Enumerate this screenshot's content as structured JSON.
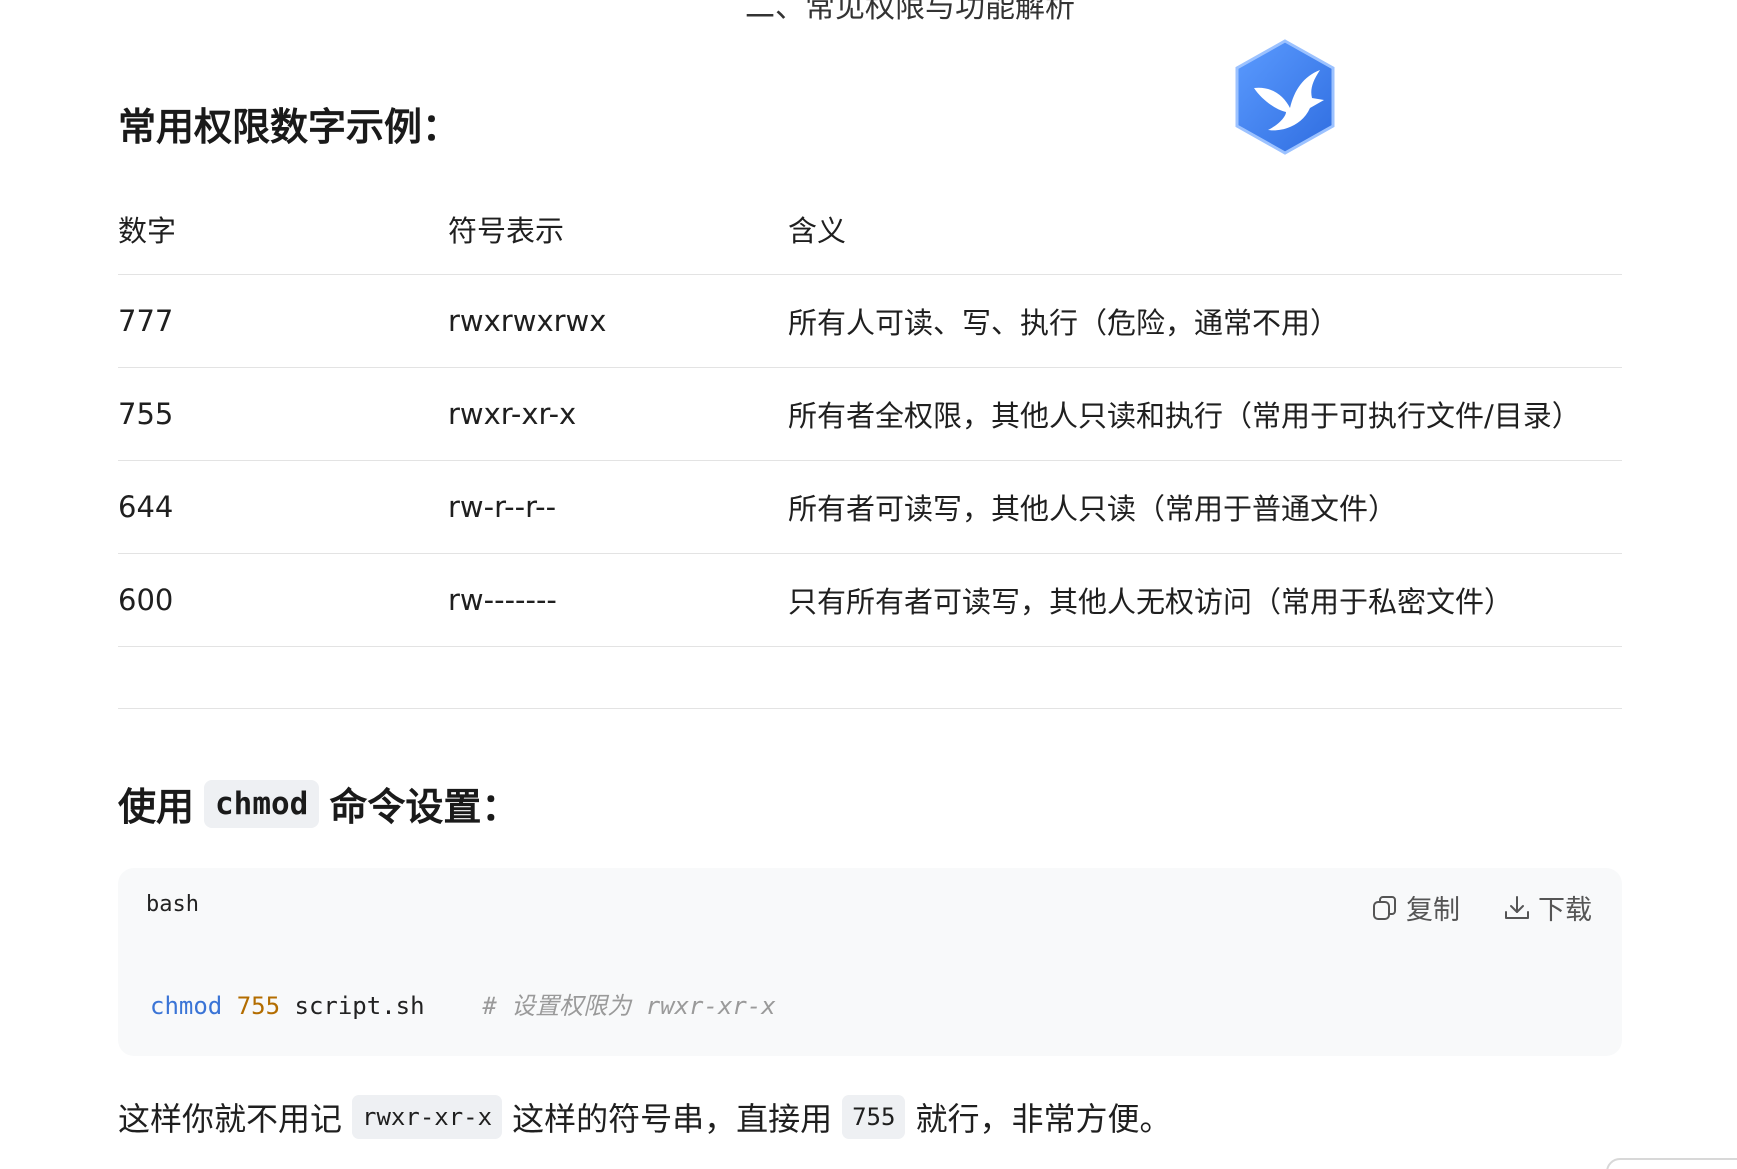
{
  "top_cut_text": "二、常见权限与功能解析",
  "section1": {
    "title": "常用权限数字示例："
  },
  "table": {
    "headers": [
      "数字",
      "符号表示",
      "含义"
    ],
    "rows": [
      [
        "777",
        "rwxrwxrwx",
        "所有人可读、写、执行（危险，通常不用）"
      ],
      [
        "755",
        "rwxr-xr-x",
        "所有者全权限，其他人只读和执行（常用于可执行文件/目录）"
      ],
      [
        "644",
        "rw-r--r--",
        "所有者可读写，其他人只读（常用于普通文件）"
      ],
      [
        "600",
        "rw-------",
        "只有所有者可读写，其他人无权访问（常用于私密文件）"
      ]
    ]
  },
  "section2": {
    "title_prefix": "使用",
    "title_code": "chmod",
    "title_suffix": "命令设置："
  },
  "code_block": {
    "language": "bash",
    "copy_label": "复制",
    "download_label": "下载",
    "tokens": {
      "cmd": "chmod",
      "num": "755",
      "arg": " script.sh",
      "comment": "# 设置权限为 rwxr-xr-x"
    }
  },
  "paragraph": {
    "part1": "这样你就不用记",
    "code1": "rwxr-xr-x",
    "part2": "这样的符号串，直接用",
    "code2": "755",
    "part3": "就行，非常方便。"
  },
  "colors": {
    "accent_blue": "#3a74d6",
    "number_orange": "#b36d00",
    "comment_gray": "#9a9a9a"
  },
  "icons": {
    "logo": "hummingbird-hexagon-logo-icon",
    "copy": "copy-icon",
    "download": "download-icon"
  }
}
